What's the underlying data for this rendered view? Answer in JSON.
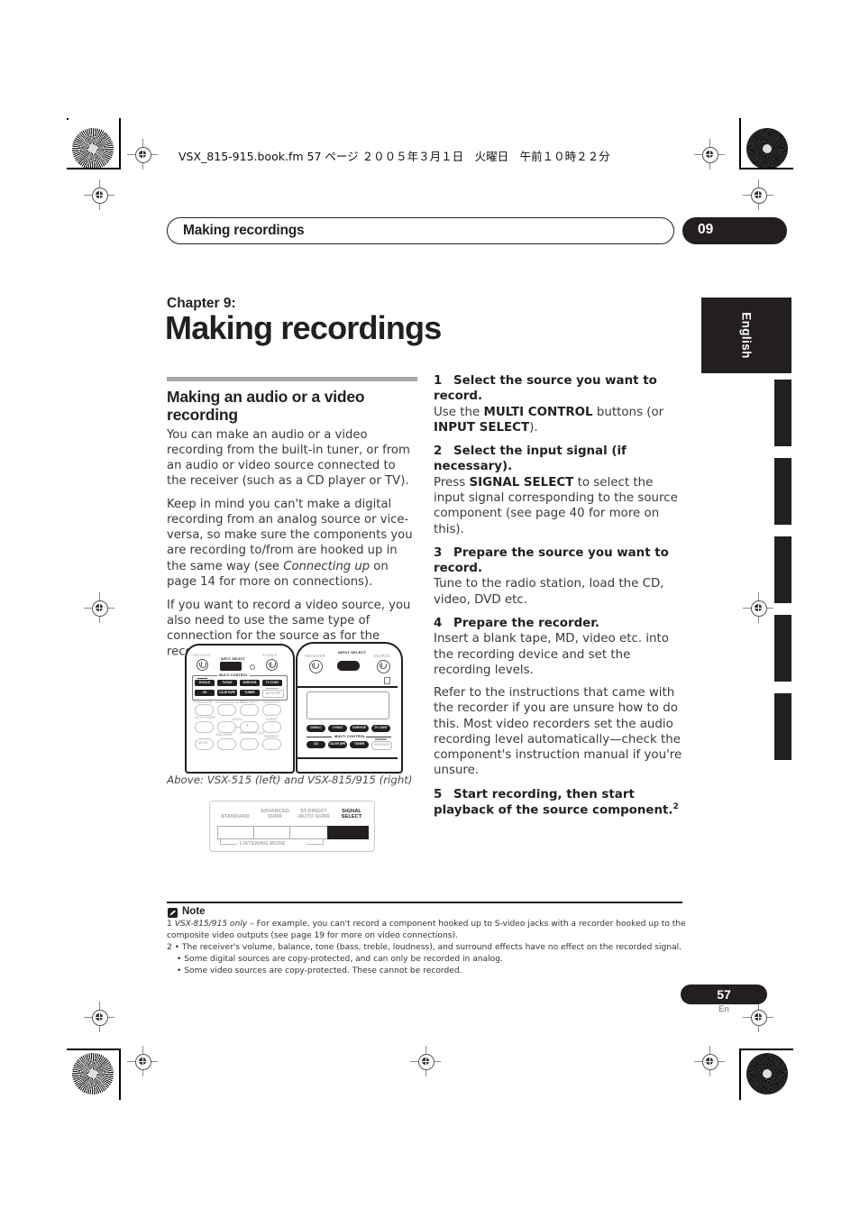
{
  "header": {
    "file_info": "VSX_815-915.book.fm  57 ページ  ２００５年３月１日　火曜日　午前１０時２２分"
  },
  "running_head": {
    "title": "Making recordings",
    "chapter_number": "09"
  },
  "side_tab": {
    "language": "English"
  },
  "chapter": {
    "label": "Chapter 9:",
    "title": "Making recordings"
  },
  "left_column": {
    "section_heading": "Making an audio or a video recording",
    "paragraph_1": "You can make an audio or a video recording from the built-in tuner, or from an audio or video source connected to the receiver (such as a CD player or TV).",
    "paragraph_2_a": "Keep in mind you can't make a digital recording from an analog source or vice-versa, so make sure the components you are recording to/from are hooked up in the same way (see ",
    "paragraph_2_italic": "Connecting up",
    "paragraph_2_b": " on page 14 for more on connections).",
    "paragraph_3": "If you want to record a video source, you also need to use the same type of connection for the source as for the recorder.",
    "paragraph_3_footnote": "1"
  },
  "right_column": {
    "steps": [
      {
        "number": "1",
        "heading": "Select the source you want to record.",
        "body_parts": [
          "Use the ",
          "MULTI CONTROL",
          " buttons (or ",
          "INPUT SELECT",
          ")."
        ]
      },
      {
        "number": "2",
        "heading": "Select the input signal (if necessary).",
        "body_parts": [
          "Press ",
          "SIGNAL SELECT",
          " to select the input signal corresponding to the source component (see page 40 for more on this)."
        ]
      },
      {
        "number": "3",
        "heading": "Prepare the source you want to record.",
        "body_parts": [
          "Tune to the radio station, load the CD, video, DVD etc."
        ]
      },
      {
        "number": "4",
        "heading": "Prepare the recorder.",
        "body_parts": [
          "Insert a blank tape, MD, video etc. into the recording device and set the recording levels."
        ],
        "extra_paragraph": "Refer to the instructions that came with the recorder if you are unsure how to do this. Most video recorders set the audio recording level automatically—check the component's instruction manual if you're unsure."
      },
      {
        "number": "5",
        "heading": "Start recording, then start playback of the source component.",
        "heading_footnote": "2",
        "body_parts": []
      }
    ]
  },
  "figure": {
    "caption": "Above: VSX-515 (left) and VSX-815/915 (right)",
    "remote_left": {
      "name": "VSX-515",
      "labels": {
        "receiver": "RECEIVER",
        "source": "SOURCE",
        "input_select": "INPUT SELECT",
        "multi_control": "MULTI CONTROL"
      },
      "multi_control_buttons": [
        "DVD/LD",
        "TV/SAT",
        "DVR/VCR",
        "TV CONT",
        "CD",
        "CD-R/TAPE",
        "TUNER",
        "RECEIVER"
      ],
      "lower_labels": [
        "STANDARD",
        "ADVANCED SURR",
        "ST.DIRECT",
        "MIDNIGHT",
        "AUTO SURR",
        "LEVEL",
        "SLEEP",
        "BALANCE",
        "ACOUSTIC EQ",
        "MUTE",
        "DIMMER"
      ]
    },
    "remote_right": {
      "name": "VSX-815/915",
      "labels": {
        "receiver": "RECEIVER",
        "source": "SOURCE",
        "input_select": "INPUT SELECT",
        "multi_control": "MULTI CONTROL"
      },
      "multi_control_buttons": [
        "DVD/LD",
        "TV/SAT",
        "DVR/VCR",
        "TV CONT",
        "CD",
        "CD-R/TAPE",
        "TUNER",
        "RECEIVER"
      ]
    }
  },
  "signal_panel": {
    "labels": [
      "STANDARD",
      "ADVANCED SURR",
      "ST.DIRECT /AUTO SURR",
      "SIGNAL SELECT"
    ],
    "label_lines": [
      [
        "",
        "STANDARD"
      ],
      [
        "ADVANCED",
        "SURR"
      ],
      [
        "ST.DIRECT",
        "/AUTO SURR"
      ],
      [
        "SIGNAL",
        "SELECT"
      ]
    ],
    "group_label": "LISTENING MODE",
    "selected": "SIGNAL SELECT"
  },
  "note": {
    "title": "Note",
    "lines": [
      {
        "indent": false,
        "text": "1 VSX-815/915 only – For example, you can't record a component hooked up to S-video jacks with a recorder hooked up to the",
        "italic_prefix": "VSX-815/915 only"
      },
      {
        "indent": false,
        "text": "composite video outputs (see page 19 for more on video connections)."
      },
      {
        "indent": false,
        "text": "2 • The receiver's volume, balance, tone (bass, treble, loudness), and surround effects have no effect on the recorded signal."
      },
      {
        "indent": true,
        "text": "• Some digital sources are copy-protected, and can only be recorded in analog."
      },
      {
        "indent": true,
        "text": "• Some video sources are copy-protected. These cannot be recorded."
      }
    ]
  },
  "footer": {
    "page_number": "57",
    "language_code": "En"
  },
  "colors": {
    "ink": "#231f20",
    "body_text": "#3a3a3a",
    "rule_gray": "#a6a6a6"
  }
}
